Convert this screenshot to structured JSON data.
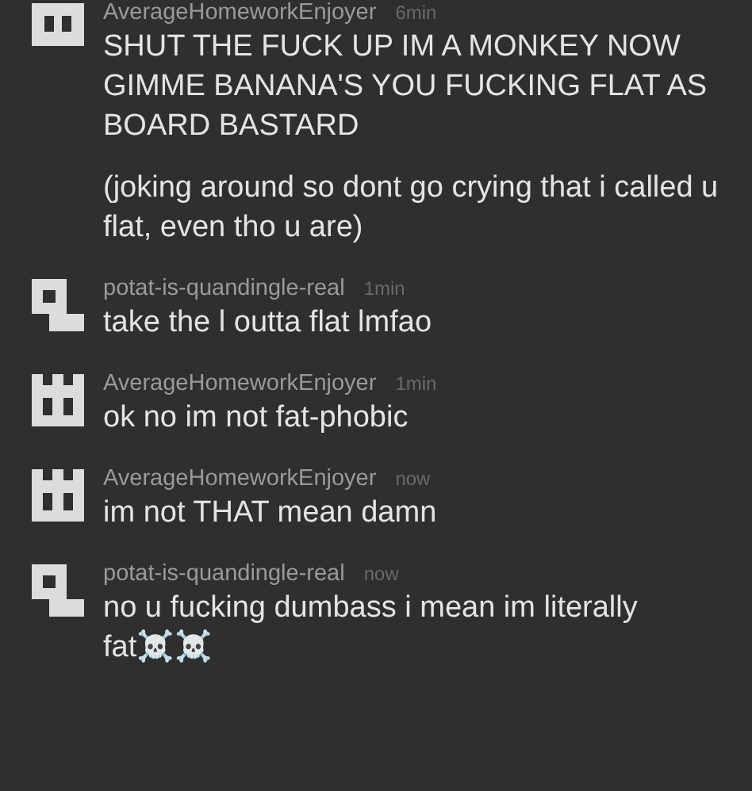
{
  "comments": [
    {
      "kind": "bars",
      "username": "AverageHomeworkEnjoyer",
      "time": "6min",
      "paragraphs": [
        "SHUT THE FUCK UP IM A MONKEY NOW GIMME BANANA'S YOU FUCKING FLAT AS BOARD BASTARD",
        "(joking around so dont go crying that i called u flat, even tho u are)"
      ]
    },
    {
      "kind": "hook",
      "username": "potat-is-quandingle-real",
      "time": "1min",
      "paragraphs": [
        "take the l outta flat lmfao"
      ]
    },
    {
      "kind": "castle",
      "username": "AverageHomeworkEnjoyer",
      "time": "1min",
      "paragraphs": [
        "ok no im not fat-phobic"
      ]
    },
    {
      "kind": "castle",
      "username": "AverageHomeworkEnjoyer",
      "time": "now",
      "paragraphs": [
        "im not THAT mean damn"
      ]
    },
    {
      "kind": "hook",
      "username": "potat-is-quandingle-real",
      "time": "now",
      "paragraphs": [
        "no u fucking dumbass i mean im literally fat☠️☠️"
      ]
    }
  ]
}
